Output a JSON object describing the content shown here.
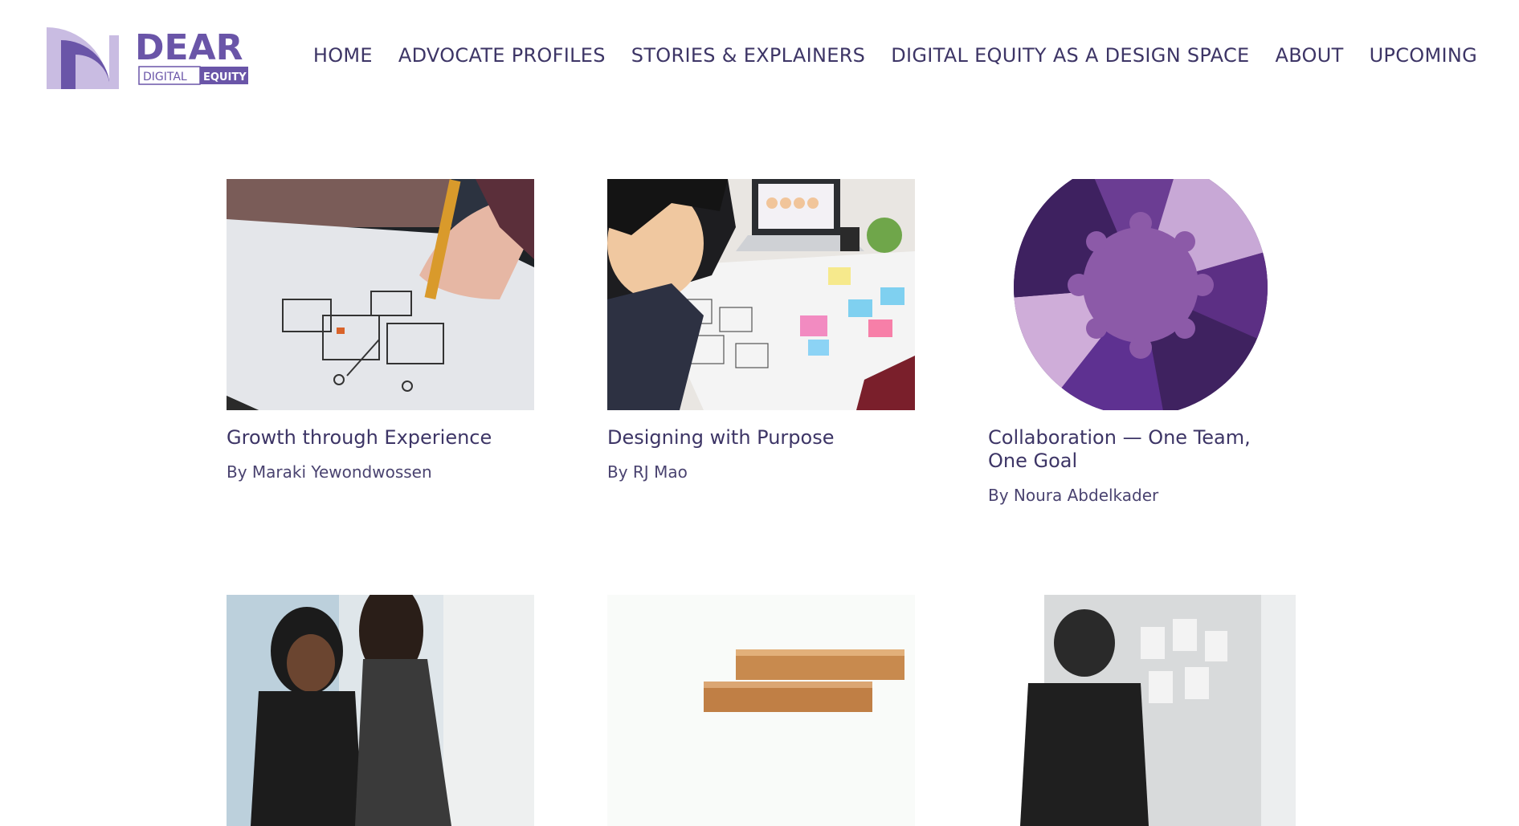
{
  "logo": {
    "word": "DEAR",
    "tag_left": "DIGITAL",
    "tag_right": "EQUITY",
    "colors": {
      "primary": "#6a55a8",
      "light": "#c9bce2"
    }
  },
  "nav": {
    "items": [
      {
        "label": "HOME"
      },
      {
        "label": "ADVOCATE PROFILES"
      },
      {
        "label": "STORIES & EXPLAINERS"
      },
      {
        "label": "DIGITAL EQUITY AS A DESIGN SPACE"
      },
      {
        "label": "ABOUT"
      },
      {
        "label": "UPCOMING"
      }
    ]
  },
  "cards": [
    {
      "title": "Growth through Experience",
      "byline": "By Maraki Yewondwossen",
      "image": "sketching-wireframes-photo"
    },
    {
      "title": "Designing with Purpose",
      "byline": "By RJ Mao",
      "image": "design-team-sticky-notes-photo"
    },
    {
      "title": "Collaboration — One Team, One Goal",
      "byline": "By Noura Abdelkader",
      "image": "purple-puzzle-circle-illustration"
    },
    {
      "title": "",
      "byline": "",
      "image": "women-at-desk-photo"
    },
    {
      "title": "",
      "byline": "",
      "image": "wooden-blocks-photo"
    },
    {
      "title": "",
      "byline": "",
      "image": "person-at-wall-photo"
    }
  ],
  "colors": {
    "text": "#3d3566",
    "accent": "#6a55a8"
  }
}
